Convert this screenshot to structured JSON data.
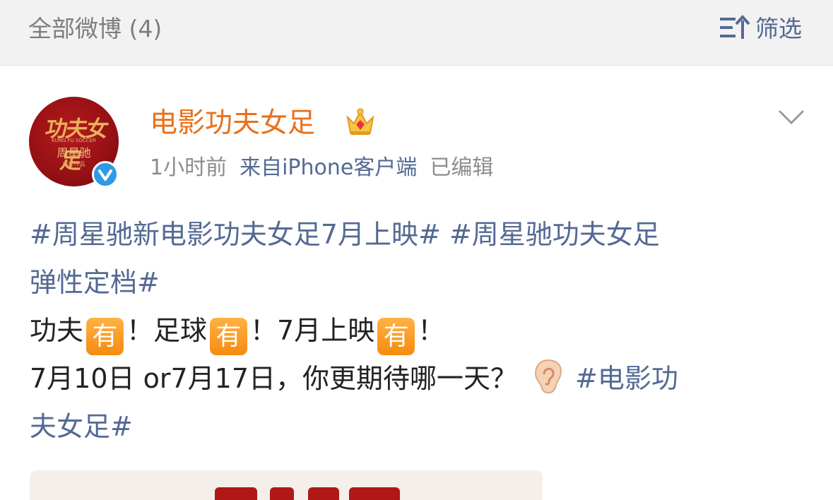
{
  "header": {
    "title": "全部微博 (4)",
    "filter_label": "筛选",
    "filter_icon": "sort-filter-icon"
  },
  "post": {
    "author": {
      "name": "电影功夫女足",
      "badge_icon": "crown-icon",
      "verified_icon": "verified-check-icon",
      "avatar": {
        "logo_text": "功夫女足",
        "logo_en": "KUNG FU SOCCER",
        "director_text": "周星驰",
        "subtitle_text": "电影作品"
      }
    },
    "meta": {
      "time": "1小时前",
      "source": "来自iPhone客户端",
      "edited": "已编辑"
    },
    "menu_icon": "chevron-down-icon",
    "content": {
      "tag1": "#周星驰新电影功夫女足7月上映#",
      "tag2_part1": "#周星驰功夫女足",
      "tag2_part2": "弹性定档#",
      "line3": {
        "t1": "功夫",
        "emoji": "有",
        "t2": "！足球",
        "t3": "！7月上映",
        "t4": "！"
      },
      "line4_text": "7月10日 or7月17日，你更期待哪一天？",
      "ear_icon": "ear-emoji-icon",
      "tag3_part1": "#电影功",
      "tag3_part2": "夫女足#"
    }
  },
  "colors": {
    "link": "#536a93",
    "username": "#e8701a",
    "meta": "#8c8c8c",
    "header_bg": "#f2f2f2"
  }
}
